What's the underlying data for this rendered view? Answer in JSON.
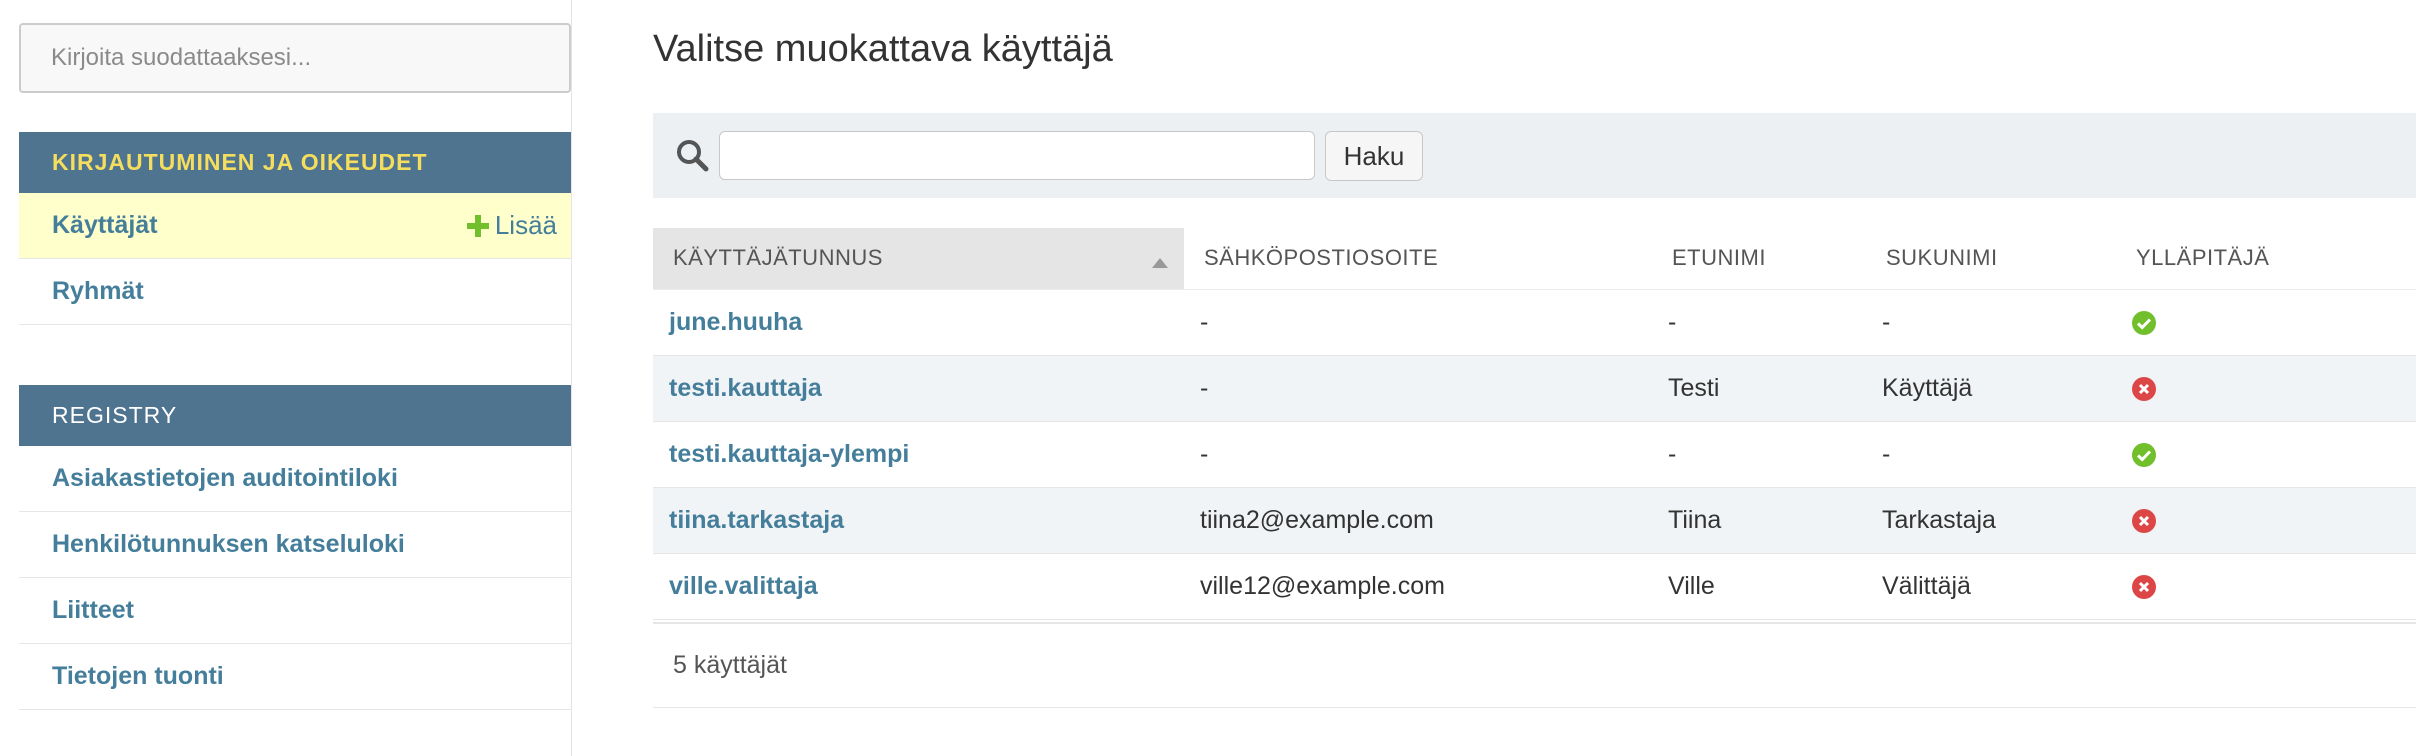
{
  "sidebar": {
    "filter_placeholder": "Kirjoita suodattaaksesi...",
    "modules": [
      {
        "caption": "KIRJAUTUMINEN JA OIKEUDET",
        "items": [
          {
            "label": "Käyttäjät",
            "add_label": "Lisää"
          },
          {
            "label": "Ryhmät"
          }
        ]
      },
      {
        "caption": "REGISTRY",
        "items": [
          {
            "label": "Asiakastietojen auditointiloki"
          },
          {
            "label": "Henkilötunnuksen katseluloki"
          },
          {
            "label": "Liitteet"
          },
          {
            "label": "Tietojen tuonti"
          }
        ]
      }
    ]
  },
  "main": {
    "title": "Valitse muokattava käyttäjä",
    "search": {
      "value": "",
      "button_label": "Haku"
    },
    "table": {
      "columns": [
        "KÄYTTÄJÄTUNNUS",
        "SÄHKÖPOSTIOSOITE",
        "ETUNIMI",
        "SUKUNIMI",
        "YLLÄPITÄJÄ"
      ],
      "rows": [
        {
          "username": "june.huuha",
          "email": "-",
          "first_name": "-",
          "last_name": "-",
          "is_staff": true
        },
        {
          "username": "testi.kauttaja",
          "email": "-",
          "first_name": "Testi",
          "last_name": "Käyttäjä",
          "is_staff": false
        },
        {
          "username": "testi.kauttaja-ylempi",
          "email": "-",
          "first_name": "-",
          "last_name": "-",
          "is_staff": true
        },
        {
          "username": "tiina.tarkastaja",
          "email": "tiina2@example.com",
          "first_name": "Tiina",
          "last_name": "Tarkastaja",
          "is_staff": false
        },
        {
          "username": "ville.valittaja",
          "email": "ville12@example.com",
          "first_name": "Ville",
          "last_name": "Välittäjä",
          "is_staff": false
        }
      ]
    },
    "result_count": "5 käyttäjät"
  },
  "colors": {
    "header": "#4f7490",
    "link": "#447e9b",
    "selected": "#ffffcc",
    "yes": "#70bf2b",
    "no": "#dd4646"
  }
}
